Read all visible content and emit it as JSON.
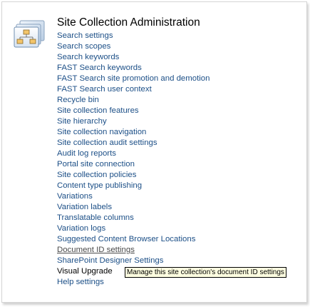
{
  "section": {
    "title": "Site Collection Administration",
    "icon": "site-hierarchy-icon"
  },
  "links": [
    {
      "label": "Search settings"
    },
    {
      "label": "Search scopes"
    },
    {
      "label": "Search keywords"
    },
    {
      "label": "FAST Search keywords"
    },
    {
      "label": "FAST Search site promotion and demotion"
    },
    {
      "label": "FAST Search user context"
    },
    {
      "label": "Recycle bin"
    },
    {
      "label": "Site collection features"
    },
    {
      "label": "Site hierarchy"
    },
    {
      "label": "Site collection navigation"
    },
    {
      "label": "Site collection audit settings"
    },
    {
      "label": "Audit log reports"
    },
    {
      "label": "Portal site connection"
    },
    {
      "label": "Site collection policies"
    },
    {
      "label": "Content type publishing"
    },
    {
      "label": "Variations"
    },
    {
      "label": "Variation labels"
    },
    {
      "label": "Translatable columns"
    },
    {
      "label": "Variation logs"
    },
    {
      "label": "Suggested Content Browser Locations"
    },
    {
      "label": "Document ID settings"
    },
    {
      "label": "SharePoint Designer Settings"
    },
    {
      "label": "Visual Upgrade"
    },
    {
      "label": "Help settings"
    }
  ],
  "tooltip": {
    "text": "Manage this site collection's document ID settings"
  },
  "colors": {
    "link": "#1c4f87",
    "tooltip_background": "#ffffe1"
  }
}
